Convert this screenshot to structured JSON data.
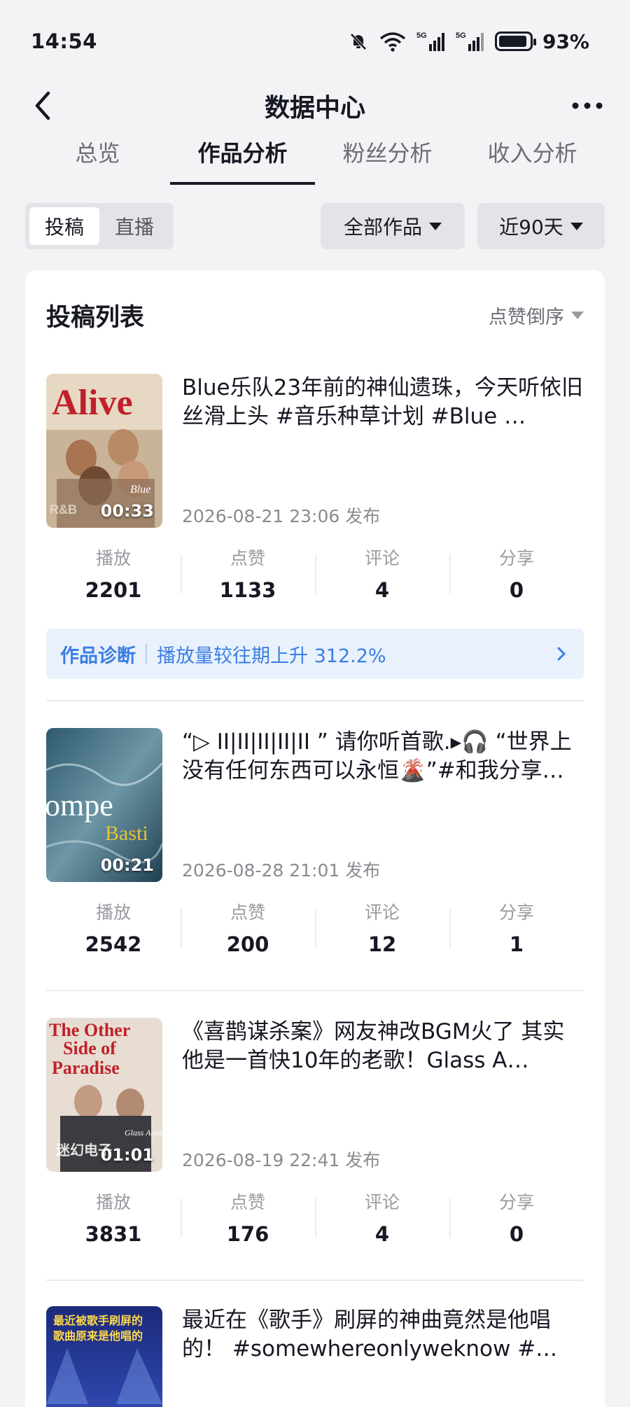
{
  "status_bar": {
    "time": "14:54",
    "battery": "93%",
    "battery_level": 0.93,
    "signal_1": "5G",
    "signal_2": "5G",
    "icons": [
      "mute-bell-icon",
      "wifi-icon",
      "signal-5g-icon",
      "signal-5g-icon",
      "battery-icon"
    ]
  },
  "nav": {
    "title": "数据中心",
    "back_icon": "chevron-left-icon",
    "more_icon": "more-dots-icon"
  },
  "tabs": [
    {
      "label": "总览",
      "active": false
    },
    {
      "label": "作品分析",
      "active": true
    },
    {
      "label": "粉丝分析",
      "active": false
    },
    {
      "label": "收入分析",
      "active": false
    }
  ],
  "filters": {
    "segments": [
      {
        "label": "投稿",
        "active": true
      },
      {
        "label": "直播",
        "active": false
      }
    ],
    "scope": "全部作品",
    "range": "近90天"
  },
  "list": {
    "title": "投稿列表",
    "sort": "点赞倒序",
    "stat_labels": {
      "play": "播放",
      "like": "点赞",
      "comment": "评论",
      "share": "分享"
    },
    "posts": [
      {
        "title": "Blue乐队23年前的神仙遗珠，今天听依旧丝滑上头 #音乐种草计划 #Blue …",
        "duration": "00:33",
        "date": "2026-08-21 23:06 发布",
        "plays": "2201",
        "likes": "1133",
        "comments": "4",
        "shares": "0",
        "thumb_text": "Alive",
        "thumb_sub": "Blue",
        "thumb_corner": "R&B",
        "diagnosis": {
          "label": "作品诊断",
          "text": "播放量较往期上升 312.2%"
        }
      },
      {
        "title": "“▷ ⅠⅠ|ⅠⅠ|ⅠⅠ|ⅠⅠ|ⅠⅠ ” 请你听首歌.▸🎧 “世界上没有任何东西可以永恒🌋”#和我分享…",
        "duration": "00:21",
        "date": "2026-08-28 21:01 发布",
        "plays": "2542",
        "likes": "200",
        "comments": "12",
        "shares": "1",
        "thumb_text": "ompe",
        "thumb_sub": "Basti"
      },
      {
        "title": "《喜鹊谋杀案》网友神改BGM火了 其实他是一首快10年的老歌！Glass A…",
        "duration": "01:01",
        "date": "2026-08-19 22:41 发布",
        "plays": "3831",
        "likes": "176",
        "comments": "4",
        "shares": "0",
        "thumb_text": "The Other",
        "thumb_text2": "Side of",
        "thumb_text3": "Paradise",
        "thumb_sub": "Glass Animals",
        "thumb_corner": "迷幻电子"
      },
      {
        "title": "最近在《歌手》刷屏的神曲竟然是他唱的！ #somewhereonlyweknow #…",
        "thumb_text": "最近被歌手刷屏的",
        "thumb_text2": "歌曲原来是他唱的"
      }
    ]
  },
  "colors": {
    "accent_blue": "#3a7ee2",
    "diagnosis_bg": "#e9f1fc",
    "text_primary": "#161823",
    "text_secondary": "#9a9ba1"
  }
}
